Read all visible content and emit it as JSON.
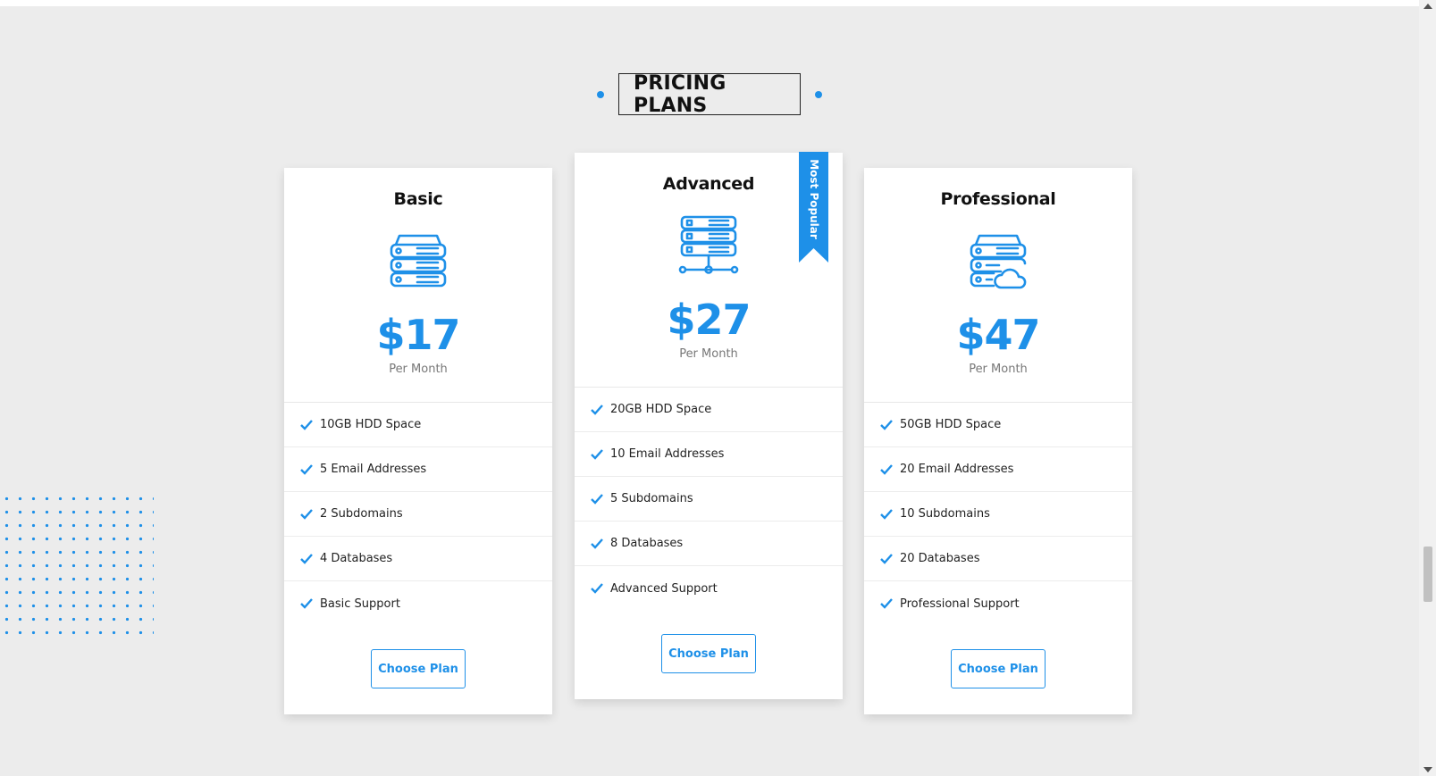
{
  "section": {
    "title": "PRICING PLANS"
  },
  "colors": {
    "accent": "#1e90e8",
    "background": "#ececec",
    "card": "#ffffff"
  },
  "plans": [
    {
      "name": "Basic",
      "icon": "server-icon",
      "price": "$17",
      "period": "Per Month",
      "features": [
        "10GB HDD Space",
        "5 Email Addresses",
        "2 Subdomains",
        "4 Databases",
        "Basic Support"
      ],
      "button": "Choose Plan"
    },
    {
      "name": "Advanced",
      "icon": "server-network-icon",
      "price": "$27",
      "period": "Per Month",
      "ribbon": "Most Popular",
      "features": [
        "20GB HDD Space",
        "10 Email Addresses",
        "5 Subdomains",
        "8 Databases",
        "Advanced Support"
      ],
      "button": "Choose Plan"
    },
    {
      "name": "Professional",
      "icon": "server-cloud-icon",
      "price": "$47",
      "period": "Per Month",
      "features": [
        "50GB HDD Space",
        "20 Email Addresses",
        "10 Subdomains",
        "20 Databases",
        "Professional Support"
      ],
      "button": "Choose Plan"
    }
  ]
}
